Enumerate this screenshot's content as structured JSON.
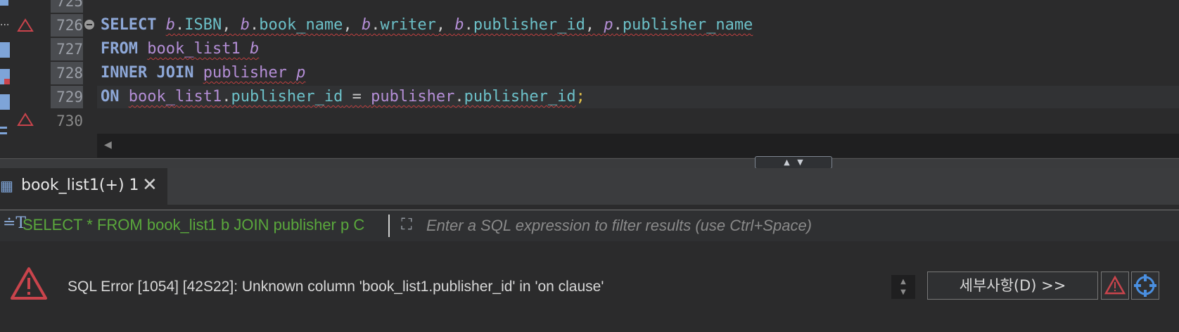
{
  "editor": {
    "lines": [
      {
        "num": "725",
        "partial": true
      },
      {
        "num": "726"
      },
      {
        "num": "727"
      },
      {
        "num": "728"
      },
      {
        "num": "729"
      },
      {
        "num": "730"
      }
    ],
    "line726": {
      "kw": "SELECT",
      "a1": "b",
      "c1": "ISBN",
      "a2": "b",
      "c2": "book_name",
      "a3": "b",
      "c3": "writer",
      "a4": "b",
      "c4": "publisher_id",
      "a5": "p",
      "c5": "publisher_name"
    },
    "line727": {
      "kw": "FROM",
      "tbl": "book_list1",
      "alias": "b"
    },
    "line728": {
      "kw": "INNER JOIN",
      "tbl": "publisher",
      "alias": "p"
    },
    "line729": {
      "kw": "ON",
      "t1": "book_list1",
      "c1": "publisher_id",
      "op": "=",
      "t2": "publisher",
      "c2": "publisher_id",
      "semi": ";"
    }
  },
  "results": {
    "tab_label": "book_list1(+) 1",
    "query_preview": "SELECT * FROM book_list1 b JOIN publisher p C",
    "filter_placeholder": "Enter a SQL expression to filter results (use Ctrl+Space)"
  },
  "error": {
    "message": "SQL Error [1054] [42S22]: Unknown column 'book_list1.publisher_id' in 'on clause'",
    "details_button": "세부사항(D) >>"
  },
  "colors": {
    "keyword": "#8ea8d8",
    "alias": "#b48ed6",
    "column": "#6cc0c8",
    "query_text": "#5aa83c",
    "error_red": "#c9444c",
    "accent_blue": "#4a8fe0"
  }
}
